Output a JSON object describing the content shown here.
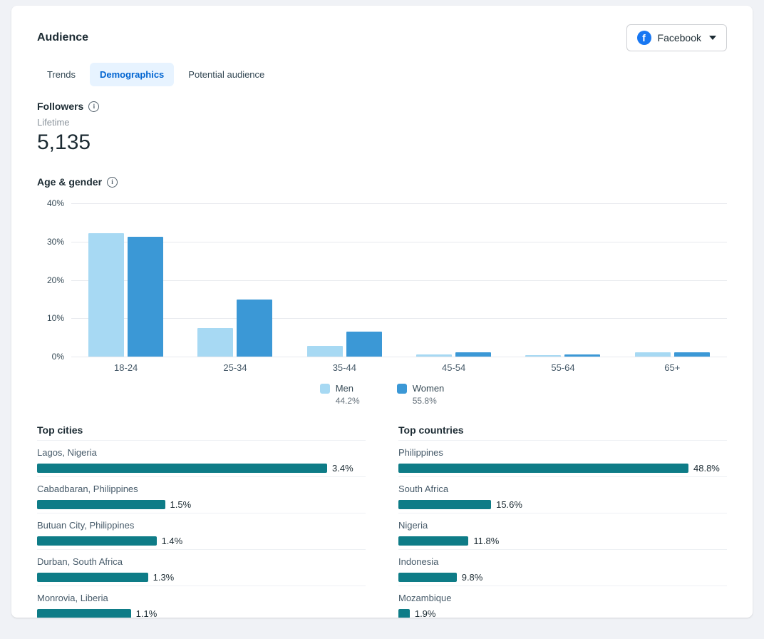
{
  "page": {
    "title": "Audience"
  },
  "platform_selector": {
    "label": "Facebook"
  },
  "tabs": [
    {
      "label": "Trends",
      "active": false
    },
    {
      "label": "Demographics",
      "active": true
    },
    {
      "label": "Potential audience",
      "active": false
    }
  ],
  "followers": {
    "heading": "Followers",
    "period": "Lifetime",
    "count": "5,135"
  },
  "age_gender": {
    "heading": "Age & gender"
  },
  "chart_data": {
    "type": "bar",
    "title": "Age & gender",
    "categories": [
      "18-24",
      "25-34",
      "35-44",
      "45-54",
      "55-64",
      "65+"
    ],
    "series": [
      {
        "name": "Men",
        "total": "44.2%",
        "color": "#a7d9f3",
        "values": [
          32.1,
          7.4,
          2.8,
          0.6,
          0.3,
          1.2
        ]
      },
      {
        "name": "Women",
        "total": "55.8%",
        "color": "#3b98d6",
        "values": [
          31.2,
          14.9,
          6.5,
          1.1,
          0.5,
          1.2
        ]
      }
    ],
    "xlabel": "",
    "ylabel": "",
    "ylim": [
      0,
      40
    ],
    "yticks": [
      "40%",
      "30%",
      "20%",
      "10%",
      "0%"
    ],
    "grid": true,
    "legend_position": "bottom"
  },
  "top_cities": {
    "heading": "Top cities",
    "max": 3.4,
    "items": [
      {
        "label": "Lagos, Nigeria",
        "value": 3.4,
        "display": "3.4%"
      },
      {
        "label": "Cabadbaran, Philippines",
        "value": 1.5,
        "display": "1.5%"
      },
      {
        "label": "Butuan City, Philippines",
        "value": 1.4,
        "display": "1.4%"
      },
      {
        "label": "Durban, South Africa",
        "value": 1.3,
        "display": "1.3%"
      },
      {
        "label": "Monrovia, Liberia",
        "value": 1.1,
        "display": "1.1%"
      }
    ]
  },
  "top_countries": {
    "heading": "Top countries",
    "max": 48.8,
    "items": [
      {
        "label": "Philippines",
        "value": 48.8,
        "display": "48.8%"
      },
      {
        "label": "South Africa",
        "value": 15.6,
        "display": "15.6%"
      },
      {
        "label": "Nigeria",
        "value": 11.8,
        "display": "11.8%"
      },
      {
        "label": "Indonesia",
        "value": 9.8,
        "display": "9.8%"
      },
      {
        "label": "Mozambique",
        "value": 1.9,
        "display": "1.9%"
      }
    ]
  },
  "colors": {
    "men": "#a7d9f3",
    "women": "#3b98d6",
    "teal_bar": "#0e7c87",
    "facebook_blue": "#1877f2",
    "active_tab": "#0064d1"
  }
}
